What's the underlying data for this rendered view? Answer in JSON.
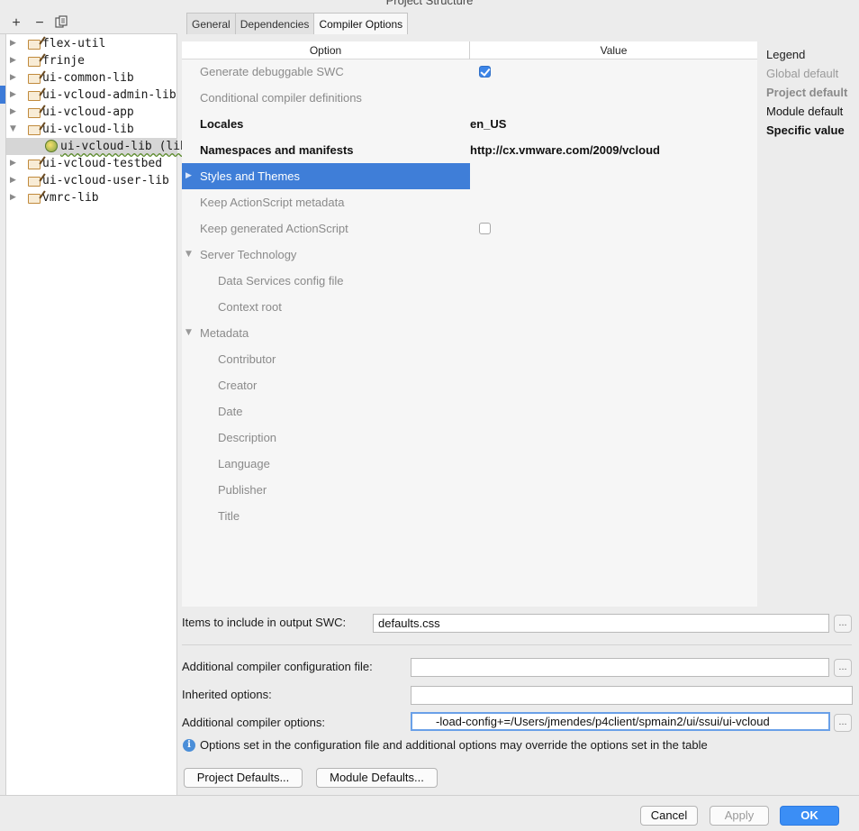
{
  "window": {
    "title": "Project Structure"
  },
  "toolbar": {
    "add": "+",
    "remove": "−",
    "copy_icon": "copy-icon"
  },
  "tree": {
    "items": [
      {
        "label": "flex-util",
        "expanded": false
      },
      {
        "label": "frinje",
        "expanded": false
      },
      {
        "label": "ui-common-lib",
        "expanded": false
      },
      {
        "label": "ui-vcloud-admin-lib",
        "expanded": false
      },
      {
        "label": "ui-vcloud-app",
        "expanded": false
      },
      {
        "label": "ui-vcloud-lib",
        "expanded": true
      },
      {
        "label": "ui-vcloud-lib (lib)",
        "child": true,
        "selected": true
      },
      {
        "label": "ui-vcloud-testbed",
        "expanded": false
      },
      {
        "label": "ui-vcloud-user-lib",
        "expanded": false
      },
      {
        "label": "vmrc-lib",
        "expanded": false
      }
    ]
  },
  "tabs": [
    {
      "label": "General",
      "active": false
    },
    {
      "label": "Dependencies",
      "active": false
    },
    {
      "label": "Compiler Options",
      "active": true
    }
  ],
  "table": {
    "headers": {
      "option": "Option",
      "value": "Value"
    },
    "rows": [
      {
        "name": "Generate debuggable SWC",
        "checkbox": true,
        "checked": true
      },
      {
        "name": "Conditional compiler definitions"
      },
      {
        "name": "Locales",
        "bold": true,
        "value": "en_US"
      },
      {
        "name": "Namespaces and manifests",
        "bold": true,
        "value": "http://cx.vmware.com/2009/vcloud"
      },
      {
        "name": "Styles and Themes",
        "selected": true,
        "collapsed": true
      },
      {
        "name": "Keep ActionScript metadata"
      },
      {
        "name": "Keep generated ActionScript",
        "checkbox": true,
        "checked": false
      },
      {
        "name": "Server Technology",
        "expanded": true
      },
      {
        "name": "Data Services config file",
        "indent": 1
      },
      {
        "name": "Context root",
        "indent": 1
      },
      {
        "name": "Metadata",
        "expanded": true
      },
      {
        "name": "Contributor",
        "indent": 1
      },
      {
        "name": "Creator",
        "indent": 1
      },
      {
        "name": "Date",
        "indent": 1
      },
      {
        "name": "Description",
        "indent": 1
      },
      {
        "name": "Language",
        "indent": 1
      },
      {
        "name": "Publisher",
        "indent": 1
      },
      {
        "name": "Title",
        "indent": 1
      }
    ]
  },
  "legend": {
    "title": "Legend",
    "items": [
      {
        "label": "Global default",
        "color": "#9a9a9a",
        "bold": false
      },
      {
        "label": "Project default",
        "color": "#8a8a8a",
        "bold": true
      },
      {
        "label": "Module default",
        "color": "#111111",
        "bold": false
      },
      {
        "label": "Specific value",
        "color": "#111111",
        "bold": true
      }
    ]
  },
  "form": {
    "items_label": "Items to include in output SWC:",
    "items_value": "defaults.css",
    "config_label": "Additional compiler configuration file:",
    "config_value": "",
    "inherited_label": "Inherited options:",
    "inherited_value": "",
    "additional_label": "Additional compiler options:",
    "additional_value": "-load-config+=/Users/jmendes/p4client/spmain2/ui/ssui/ui-vcloud",
    "browse": "..."
  },
  "info": {
    "icon": "info-icon",
    "text": "Options set in the configuration file and additional options may override the options set in the table"
  },
  "buttons": {
    "project_defaults": "Project Defaults...",
    "module_defaults": "Module Defaults...",
    "cancel": "Cancel",
    "apply": "Apply",
    "ok": "OK"
  },
  "colors": {
    "selection": "#3f7ed8",
    "primary_button": "#3b8ef5"
  }
}
